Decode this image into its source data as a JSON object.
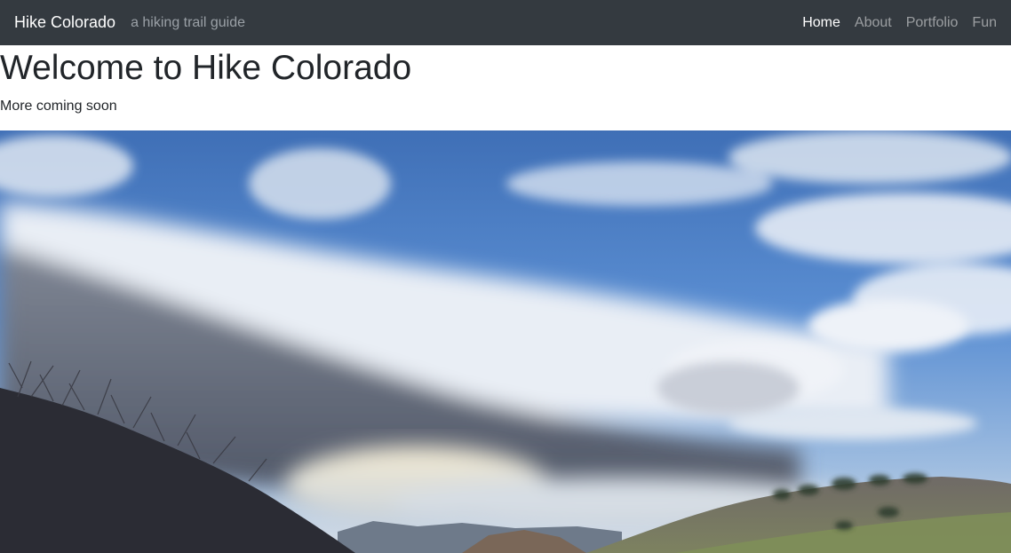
{
  "navbar": {
    "brand": "Hike Colorado",
    "tagline": "a hiking trail guide",
    "links": [
      {
        "label": "Home",
        "active": true
      },
      {
        "label": "About",
        "active": false
      },
      {
        "label": "Portfolio",
        "active": false
      },
      {
        "label": "Fun",
        "active": false
      }
    ],
    "background": "#343a40"
  },
  "main": {
    "heading": "Welcome to Hike Colorado",
    "subtext": "More coming soon"
  },
  "colors": {
    "sky": "#4a7fc7",
    "clouds": "#e8eef6",
    "hills": "#6f6a62"
  }
}
